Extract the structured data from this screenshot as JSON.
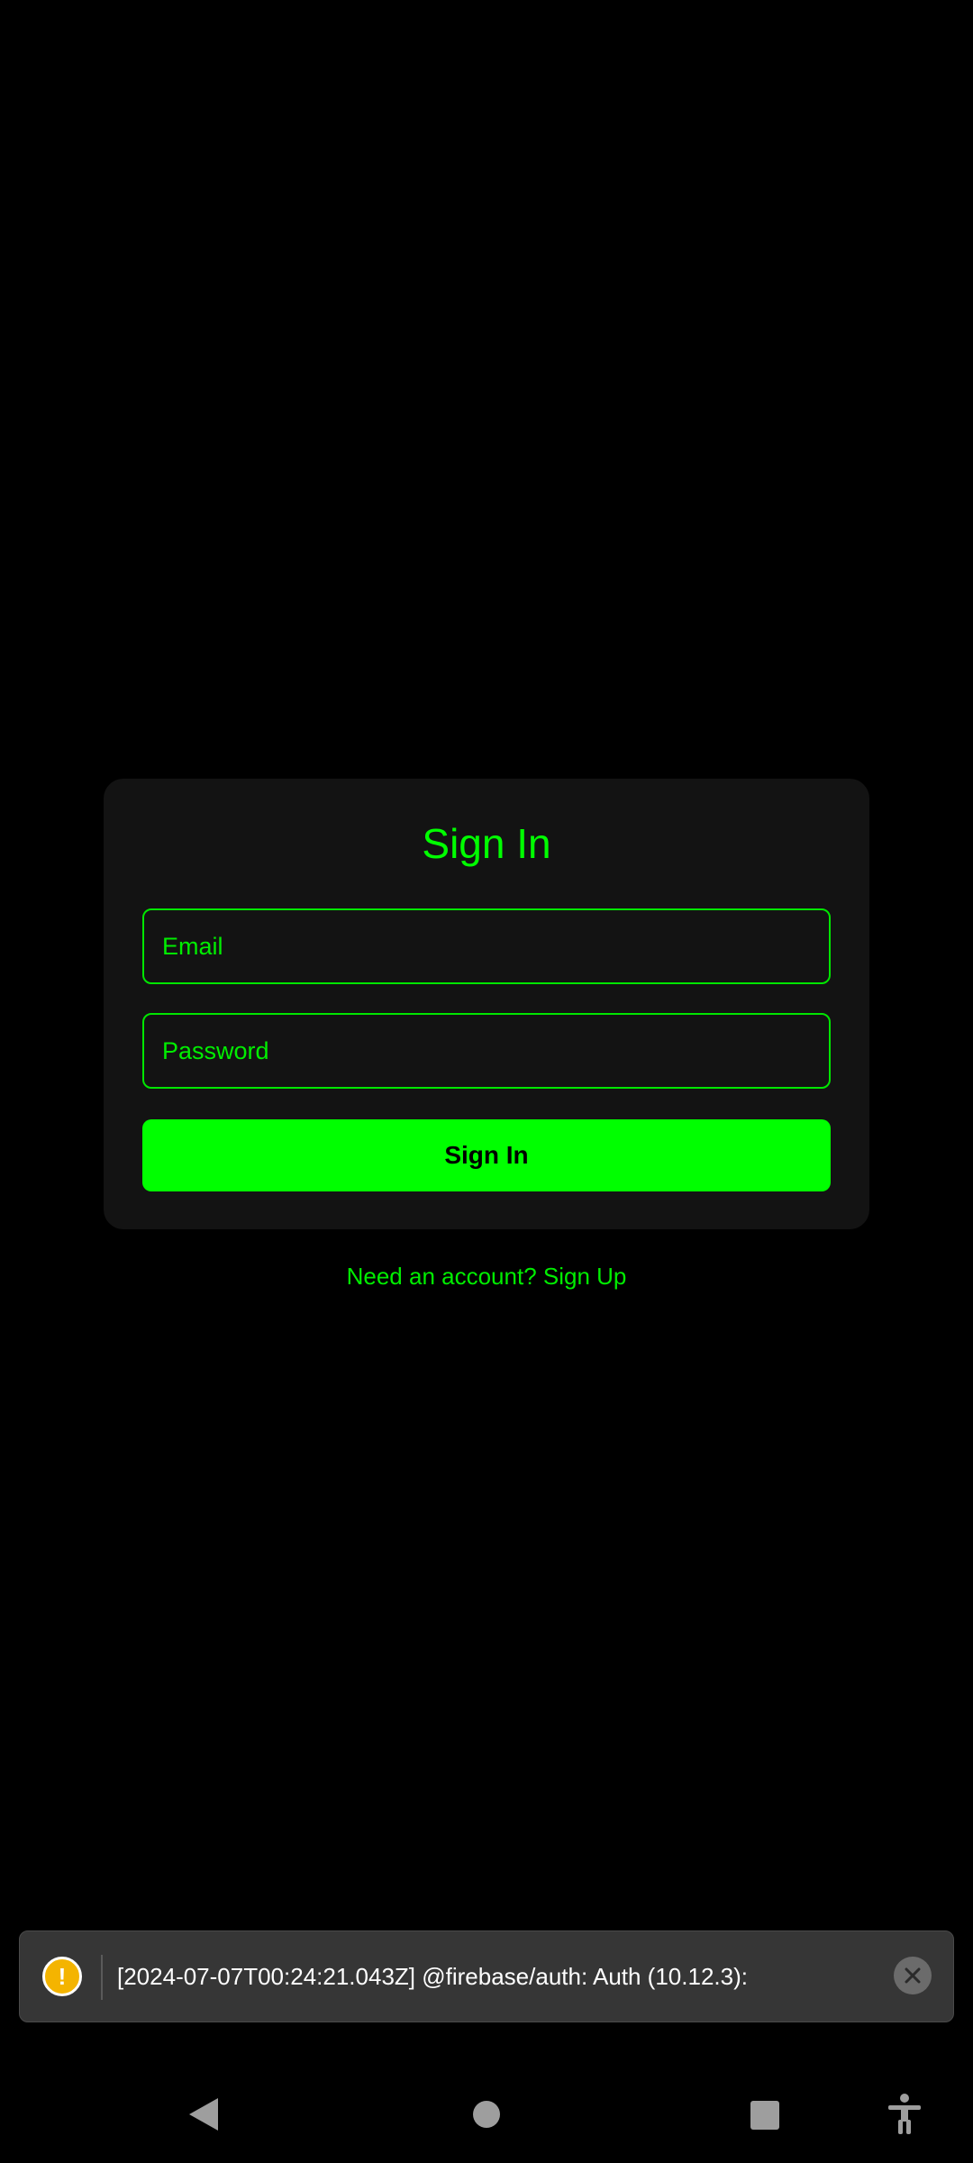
{
  "signin": {
    "title": "Sign In",
    "email_placeholder": "Email",
    "password_placeholder": "Password",
    "button_label": "Sign In",
    "signup_link": "Need an account? Sign Up"
  },
  "toast": {
    "message": "[2024-07-07T00:24:21.043Z]  @firebase/auth: Auth (10.12.3):",
    "icon": "warning-icon"
  },
  "navbar": {
    "back_icon": "back-icon",
    "home_icon": "home-icon",
    "recents_icon": "recents-icon",
    "accessibility_icon": "accessibility-icon"
  },
  "colors": {
    "accent": "#00ff00",
    "background": "#000000",
    "card": "#131313",
    "toast": "#363636",
    "warning": "#f4b400"
  }
}
